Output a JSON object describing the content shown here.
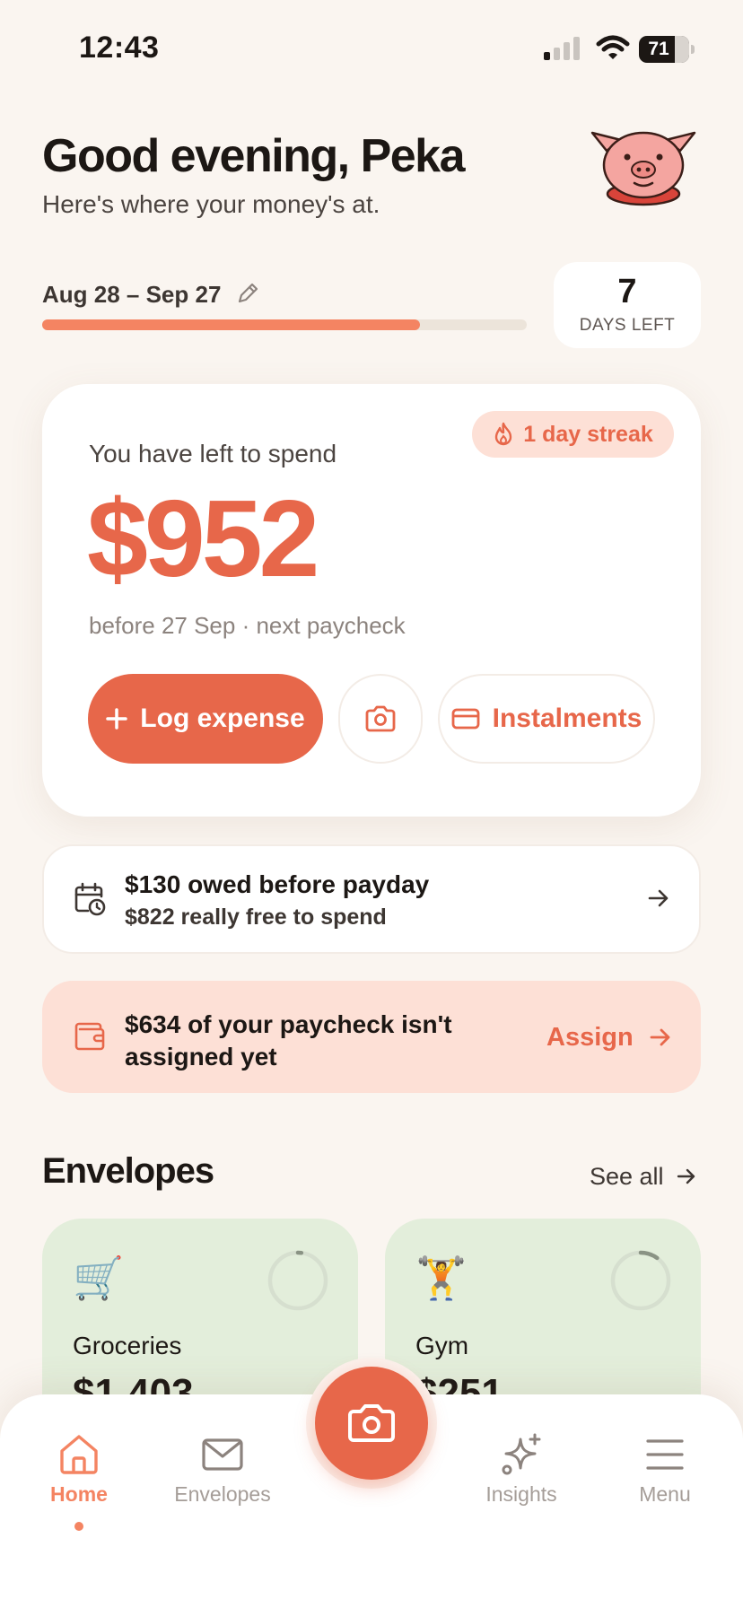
{
  "status_bar": {
    "time": "12:43",
    "battery": "71",
    "battery_level": 0.71
  },
  "header": {
    "greeting": "Good evening, Peka",
    "subtitle": "Here's where your money's at.",
    "avatar": "pig-avatar"
  },
  "period": {
    "label": "Aug 28 – Sep 27",
    "progress": 0.78,
    "days_left_number": "7",
    "days_left_label": "DAYS LEFT"
  },
  "spend_card": {
    "streak": "1 day streak",
    "label": "You have left to spend",
    "amount": "$952",
    "subtext": "before 27 Sep · next paycheck",
    "log_expense_label": "Log expense",
    "instalments_label": "Instalments"
  },
  "owed": {
    "title": "$130 owed before payday",
    "subtitle": "$822 really free to spend"
  },
  "assign": {
    "text": "$634 of your paycheck isn't assigned yet",
    "link": "Assign"
  },
  "envelopes": {
    "title": "Envelopes",
    "see_all": "See all",
    "items": [
      {
        "icon": "shopping-cart-icon",
        "emoji": "🛒",
        "name": "Groceries",
        "amount": "$1,403",
        "progress": 0.02
      },
      {
        "icon": "weightlifter-icon",
        "emoji": "🏋️",
        "name": "Gym",
        "amount": "$251",
        "progress": 0.1
      }
    ]
  },
  "tab_bar": {
    "home": "Home",
    "envelopes": "Envelopes",
    "insights": "Insights",
    "menu": "Menu"
  },
  "colors": {
    "accent": "#e7674a",
    "accent_light": "#f48462",
    "background": "#faf5f0",
    "alert_bg": "#fde0d6",
    "envelope_bg": "#e3eedb"
  }
}
